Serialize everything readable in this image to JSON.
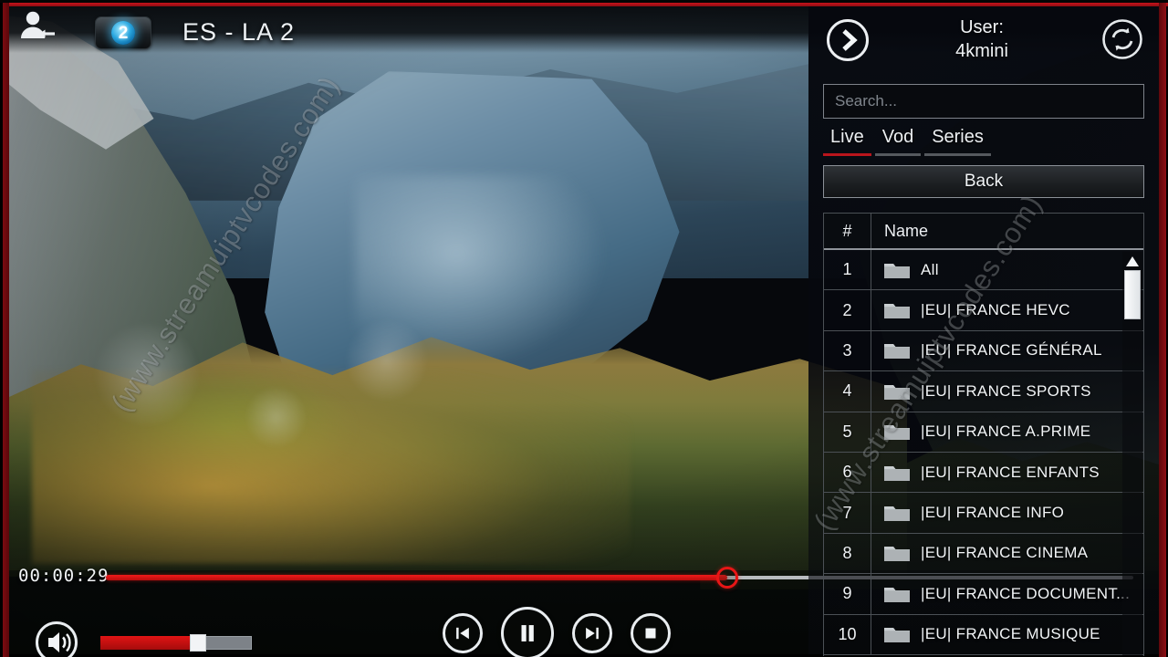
{
  "player": {
    "channel_title": "ES - LA 2",
    "channel_logo_number": "2",
    "timecode": "00:00:29",
    "seek_percent": 60.5,
    "volume_percent": 59,
    "user_icon": "user-logout-icon",
    "controls": {
      "previous_label": "previous-track",
      "pause_label": "pause",
      "next_label": "next-track",
      "stop_label": "stop",
      "volume_label": "volume"
    }
  },
  "watermark": {
    "text_left": "(www.streamuiptvcodes.com)",
    "text_right": "(www.streamuiptvcodes.com)"
  },
  "panel": {
    "nav_icon": "chevron-right-circle-icon",
    "refresh_icon": "refresh-circle-icon",
    "user_label": "User:",
    "user_name": "4kmini",
    "search": {
      "placeholder": "Search...",
      "value": ""
    },
    "tabs": [
      {
        "label": "Live",
        "active": true
      },
      {
        "label": "Vod",
        "active": false
      },
      {
        "label": "Series",
        "active": false
      }
    ],
    "back_label": "Back",
    "list": {
      "columns": [
        "#",
        "Name"
      ],
      "rows": [
        {
          "num": "1",
          "name": "All"
        },
        {
          "num": "2",
          "name": "|EU| FRANCE HEVC"
        },
        {
          "num": "3",
          "name": "|EU| FRANCE GÉNÉRAL"
        },
        {
          "num": "4",
          "name": "|EU| FRANCE SPORTS"
        },
        {
          "num": "5",
          "name": "|EU| FRANCE A.PRIME"
        },
        {
          "num": "6",
          "name": "|EU| FRANCE ENFANTS"
        },
        {
          "num": "7",
          "name": "|EU| FRANCE INFO"
        },
        {
          "num": "8",
          "name": "|EU| FRANCE CINEMA"
        },
        {
          "num": "9",
          "name": "|EU| FRANCE DOCUMENT..."
        },
        {
          "num": "10",
          "name": "|EU| FRANCE MUSIQUE"
        }
      ]
    }
  },
  "colors": {
    "frame_red": "#c7131b",
    "accent_red": "#b9151c",
    "progress_red": "#e81616",
    "panel_bg": "#06080e",
    "text": "#f0f3f6",
    "muted_text": "#7f858c",
    "logo_blue": "#2ba8e0"
  }
}
